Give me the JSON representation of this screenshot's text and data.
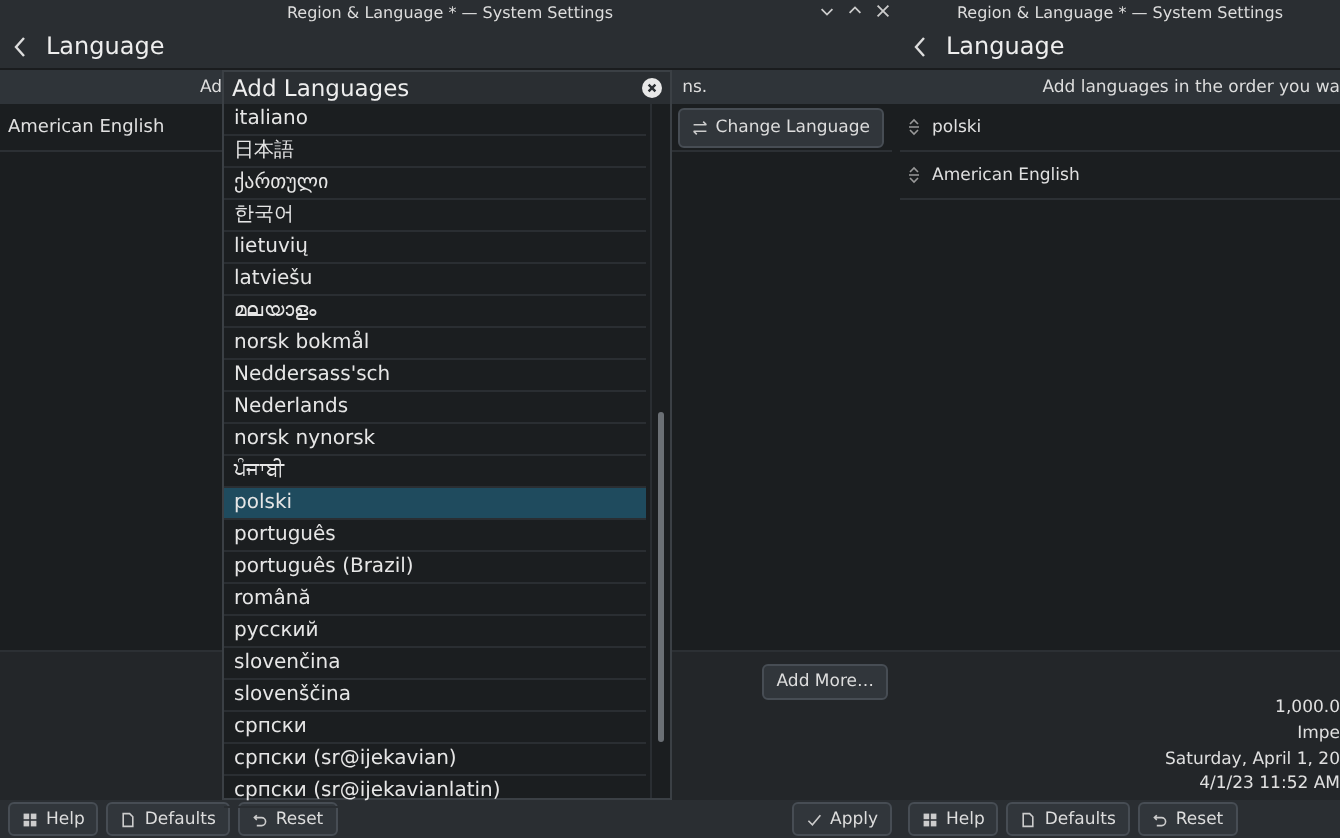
{
  "window": {
    "title": "Region & Language * — System Settings",
    "header": "Language",
    "subtitle_parts": [
      "Ad",
      "ns."
    ],
    "languages": [
      "American English"
    ],
    "change_button": "Change Language",
    "add_more_button": "Add More…",
    "footer_buttons": [
      {
        "label": "Help",
        "kind": "help"
      },
      {
        "label": "Defaults",
        "kind": "defaults"
      },
      {
        "label": "Reset",
        "kind": "reset"
      }
    ],
    "apply_button": "Apply",
    "dialog": {
      "title": "Add Languages",
      "items": [
        {
          "label": "italiano",
          "selected": false
        },
        {
          "label": "日本語",
          "selected": false
        },
        {
          "label": "ქართული",
          "selected": false
        },
        {
          "label": "한국어",
          "selected": false
        },
        {
          "label": "lietuvių",
          "selected": false
        },
        {
          "label": "latviešu",
          "selected": false
        },
        {
          "label": "മലയാളം",
          "selected": false
        },
        {
          "label": "norsk bokmål",
          "selected": false
        },
        {
          "label": "Neddersass'sch",
          "selected": false
        },
        {
          "label": "Nederlands",
          "selected": false
        },
        {
          "label": "norsk nynorsk",
          "selected": false
        },
        {
          "label": "ਪੰਜਾਬੀ",
          "selected": false
        },
        {
          "label": "polski",
          "selected": true
        },
        {
          "label": "português",
          "selected": false
        },
        {
          "label": "português (Brazil)",
          "selected": false
        },
        {
          "label": "română",
          "selected": false
        },
        {
          "label": "русский",
          "selected": false
        },
        {
          "label": "slovenčina",
          "selected": false
        },
        {
          "label": "slovenščina",
          "selected": false
        },
        {
          "label": "српски",
          "selected": false
        },
        {
          "label": "српски (sr@ijekavian)",
          "selected": false
        },
        {
          "label": "српски (sr@ijekavianlatin)",
          "selected": false
        }
      ]
    }
  },
  "second_window": {
    "title": "Region & Language * — System Settings",
    "header": "Language",
    "subtitle": "Add languages in the order you wa",
    "languages": [
      "polski",
      "American English"
    ],
    "details": [
      "1,000.0",
      "Impe",
      "Saturday, April 1, 20",
      "4/1/23 11:52 AM"
    ],
    "footer_buttons": [
      {
        "label": "Help",
        "kind": "help"
      },
      {
        "label": "Defaults",
        "kind": "defaults"
      },
      {
        "label": "Reset",
        "kind": "reset"
      }
    ]
  }
}
